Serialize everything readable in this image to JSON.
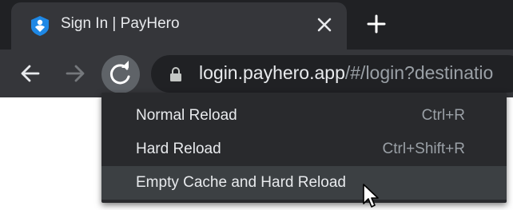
{
  "tab": {
    "title": "Sign In | PayHero",
    "favicon": "payhero-logo-icon",
    "close_icon": "close-icon"
  },
  "new_tab_icon": "plus-icon",
  "toolbar": {
    "back_icon": "arrow-left-icon",
    "forward_icon": "arrow-right-icon",
    "reload_icon": "reload-icon",
    "lock_icon": "lock-icon",
    "url_host": "login.payhero.app",
    "url_path": "/#/login?destinatio"
  },
  "context_menu": {
    "items": [
      {
        "label": "Normal Reload",
        "shortcut": "Ctrl+R"
      },
      {
        "label": "Hard Reload",
        "shortcut": "Ctrl+Shift+R"
      },
      {
        "label": "Empty Cache and Hard Reload",
        "shortcut": ""
      }
    ],
    "hovered_index": 2
  },
  "colors": {
    "tabstrip_bg": "#202124",
    "active_tab_bg": "#35363a",
    "menu_bg": "#292a2d",
    "menu_hover_bg": "#3c4043",
    "text": "#e8eaed",
    "muted_text": "#9aa0a6",
    "favicon_blue": "#1e88e5"
  }
}
